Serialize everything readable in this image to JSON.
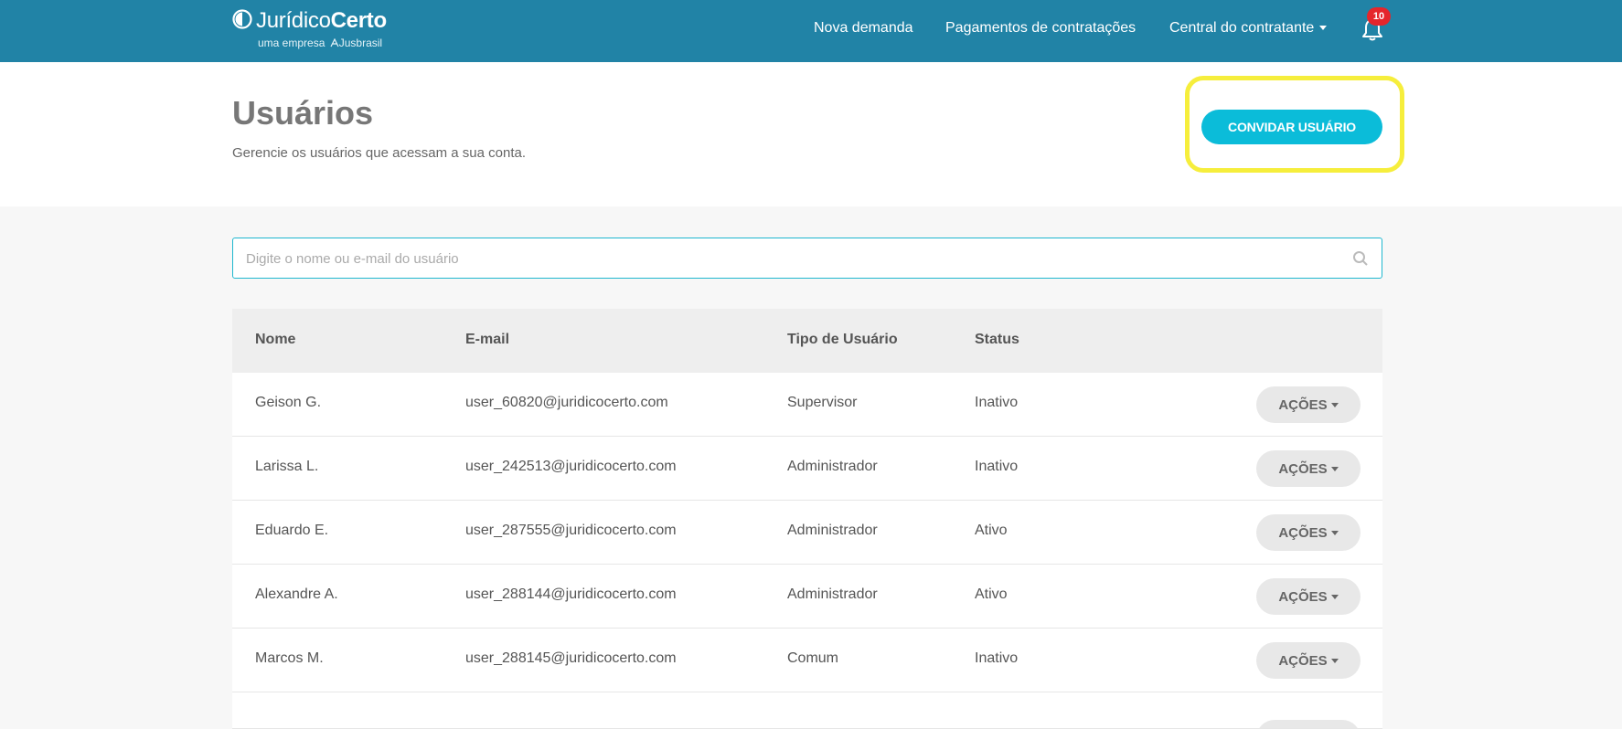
{
  "brand": {
    "name_light": "Jurídico",
    "name_bold": "Certo",
    "tagline": "uma empresa",
    "parent": "Jusbrasil"
  },
  "nav": {
    "nova_demanda": "Nova demanda",
    "pagamentos": "Pagamentos de contratações",
    "central": "Central do contratante",
    "notifications_count": "10"
  },
  "header": {
    "title": "Usuários",
    "subtitle": "Gerencie os usuários que acessam a sua conta.",
    "invite_label": "CONVIDAR USUÁRIO"
  },
  "search": {
    "placeholder": "Digite o nome ou e-mail do usuário",
    "value": ""
  },
  "table": {
    "columns": [
      "Nome",
      "E-mail",
      "Tipo de Usuário",
      "Status"
    ],
    "action_label": "AÇÕES",
    "rows": [
      {
        "nome": "Geison G.",
        "email": "user_60820@juridicocerto.com",
        "tipo": "Supervisor",
        "status": "Inativo"
      },
      {
        "nome": "Larissa L.",
        "email": "user_242513@juridicocerto.com",
        "tipo": "Administrador",
        "status": "Inativo"
      },
      {
        "nome": "Eduardo E.",
        "email": "user_287555@juridicocerto.com",
        "tipo": "Administrador",
        "status": "Ativo"
      },
      {
        "nome": "Alexandre A.",
        "email": "user_288144@juridicocerto.com",
        "tipo": "Administrador",
        "status": "Ativo"
      },
      {
        "nome": "Marcos M.",
        "email": "user_288145@juridicocerto.com",
        "tipo": "Comum",
        "status": "Inativo"
      }
    ]
  },
  "colors": {
    "topbar": "#2183a6",
    "accent": "#0bbcd9",
    "highlight": "#f6ee3c",
    "badge": "#e5262b"
  },
  "icons": {
    "logo": "logo-mark-icon",
    "bell": "bell-icon",
    "search": "search-icon",
    "caret": "caret-down-icon"
  }
}
